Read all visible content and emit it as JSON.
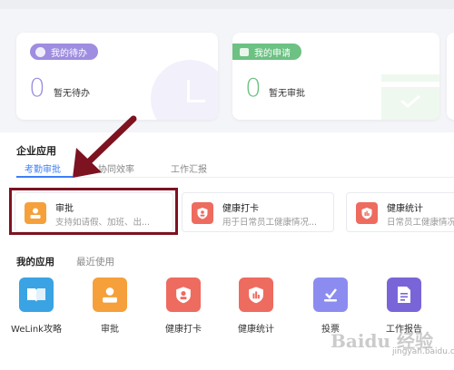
{
  "colors": {
    "accent": "#3d7ef7",
    "todo_purple": "#9e8de0",
    "apply_green": "#6cc183",
    "approve_orange": "#f5a03b",
    "health_red": "#ee6b5f",
    "vote_purple": "#8c8cf0",
    "report_purple": "#7a65d8",
    "welink_blue": "#3aa3e3",
    "annotation_dark_red": "#7d1221"
  },
  "cards": {
    "todo": {
      "label": "我的待办",
      "count": "0",
      "text": "暂无待办",
      "icon": "clock-icon"
    },
    "apply": {
      "label": "我的申请",
      "count": "0",
      "text": "暂无审批",
      "icon": "calendar-icon"
    }
  },
  "enterprise": {
    "title": "企业应用",
    "tabs": [
      "考勤审批",
      "协同效率",
      "工作汇报"
    ],
    "apps": [
      {
        "name": "审批",
        "desc": "支持如请假、加班、出...",
        "icon": "person-stamp-icon"
      },
      {
        "name": "健康打卡",
        "desc": "用于日常员工健康情况...",
        "icon": "shield-person-icon"
      },
      {
        "name": "健康统计",
        "desc": "日常员工健康情况",
        "icon": "shield-chart-icon"
      }
    ]
  },
  "my_apps": {
    "tabs": [
      "我的应用",
      "最近使用"
    ],
    "apps": [
      {
        "name": "WeLink攻略",
        "icon": "book-icon"
      },
      {
        "name": "审批",
        "icon": "person-stamp-icon"
      },
      {
        "name": "健康打卡",
        "icon": "shield-person-icon"
      },
      {
        "name": "健康统计",
        "icon": "shield-chart-icon"
      },
      {
        "name": "投票",
        "icon": "ballot-icon"
      },
      {
        "name": "工作报告",
        "icon": "document-icon"
      }
    ]
  },
  "watermark": {
    "main": "Baidu 经验",
    "sub": "jingyan.baidu.com"
  }
}
